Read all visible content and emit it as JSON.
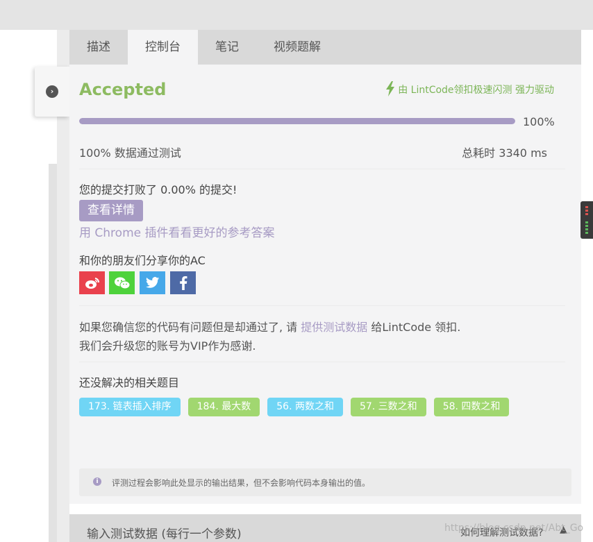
{
  "tabs": [
    {
      "label": "描述",
      "active": false
    },
    {
      "label": "控制台",
      "active": true
    },
    {
      "label": "笔记",
      "active": false
    },
    {
      "label": "视频题解",
      "active": false
    }
  ],
  "result": {
    "status": "Accepted",
    "status_color": "#8dbb61",
    "powered_by": "由 LintCode领扣极速闪测 强力驱动",
    "progress_percent": 100,
    "progress_label": "100%",
    "pass_text": "100% 数据通过测试",
    "time_text": "总耗时 3340 ms"
  },
  "beat": {
    "text": "您的提交打败了 0.00% 的提交!",
    "detail_button": "查看详情",
    "chrome_link": "用 Chrome 插件看看更好的参考答案"
  },
  "share": {
    "label": "和你的朋友们分享你的AC",
    "icons": [
      "weibo-icon",
      "wechat-icon",
      "twitter-icon",
      "facebook-icon"
    ]
  },
  "issue": {
    "line1_prefix": "如果您确信您的代码有问题但是却通过了, 请 ",
    "line1_link": "提供测试数据",
    "line1_suffix": " 给LintCode 领扣.",
    "line2": "我们会升级您的账号为VIP作为感谢."
  },
  "related": {
    "label": "还没解决的相关题目",
    "tags": [
      {
        "label": "173. 链表插入排序",
        "color": "blue"
      },
      {
        "label": "184. 最大数",
        "color": "green"
      },
      {
        "label": "56. 两数之和",
        "color": "blue"
      },
      {
        "label": "57. 三数之和",
        "color": "green"
      },
      {
        "label": "58. 四数之和",
        "color": "green"
      }
    ]
  },
  "notice": {
    "text": "评测过程会影响此处显示的输出结果，但不会影响代码本身输出的值。"
  },
  "bottom": {
    "input_label": "输入测试数据 (每行一个参数)",
    "right_label": "如何理解测试数据?"
  },
  "watermark": "https://blog.csdn.net/Abt_Go",
  "colors": {
    "accent": "#a79bc4",
    "success": "#8dbb61",
    "tag_blue": "#70d5f5",
    "tag_green": "#a1d770"
  }
}
